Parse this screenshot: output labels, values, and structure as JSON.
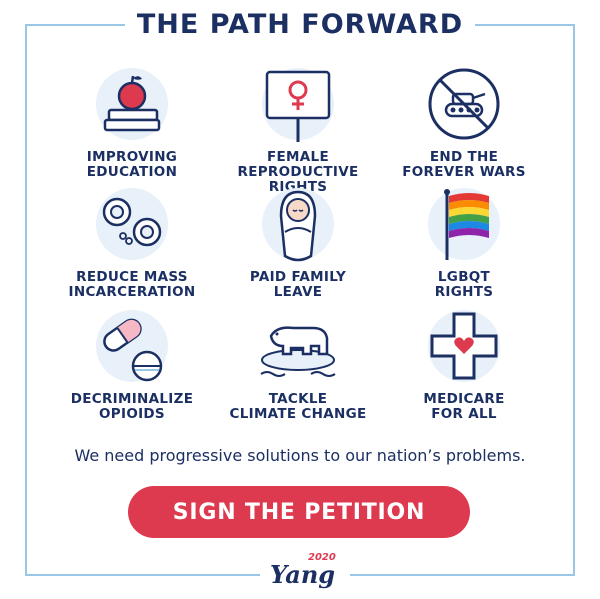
{
  "title": "THE PATH FORWARD",
  "items": [
    {
      "lines": [
        "IMPROVING",
        "EDUCATION"
      ],
      "icon": "apple-books-icon"
    },
    {
      "lines": [
        "FEMALE",
        "REPRODUCTIVE",
        "RIGHTS"
      ],
      "icon": "female-sign-icon"
    },
    {
      "lines": [
        "END THE",
        "FOREVER WARS"
      ],
      "icon": "no-tank-icon"
    },
    {
      "lines": [
        "REDUCE MASS",
        "INCARCERATION"
      ],
      "icon": "handcuffs-icon"
    },
    {
      "lines": [
        "PAID FAMILY",
        "LEAVE"
      ],
      "icon": "swaddled-baby-icon"
    },
    {
      "lines": [
        "LGBQT",
        "RIGHTS"
      ],
      "icon": "rainbow-flag-icon"
    },
    {
      "lines": [
        "DECRIMINALIZE",
        "OPIOIDS"
      ],
      "icon": "pills-icon"
    },
    {
      "lines": [
        "TACKLE",
        "CLIMATE CHANGE"
      ],
      "icon": "polar-bear-icon"
    },
    {
      "lines": [
        "MEDICARE",
        "FOR ALL"
      ],
      "icon": "medical-cross-icon"
    }
  ],
  "tagline": "We need progressive solutions to our nation’s problems.",
  "cta_label": "SIGN THE PETITION",
  "logo": {
    "name": "Yang",
    "year": "2020"
  },
  "colors": {
    "navy": "#1b2f63",
    "red": "#de3a4f",
    "light_blue": "#9bc7e7",
    "icon_bg": "#e8f1fa"
  }
}
